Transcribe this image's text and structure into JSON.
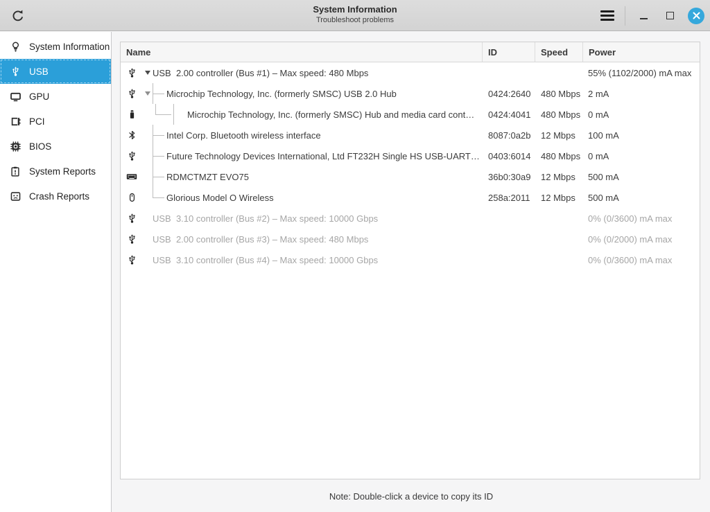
{
  "window": {
    "title": "System Information",
    "subtitle": "Troubleshoot problems"
  },
  "titlebar_icons": [
    "refresh-icon",
    "hamburger-menu-icon",
    "minimize-icon",
    "maximize-icon",
    "close-icon"
  ],
  "sidebar": {
    "items": [
      {
        "label": "System Information",
        "icon": "lightbulb",
        "selected": false
      },
      {
        "label": "USB",
        "icon": "usb",
        "selected": true
      },
      {
        "label": "GPU",
        "icon": "monitor",
        "selected": false
      },
      {
        "label": "PCI",
        "icon": "pci-card",
        "selected": false
      },
      {
        "label": "BIOS",
        "icon": "chip",
        "selected": false
      },
      {
        "label": "System Reports",
        "icon": "report",
        "selected": false
      },
      {
        "label": "Crash Reports",
        "icon": "crash",
        "selected": false
      }
    ]
  },
  "table": {
    "columns": [
      "Name",
      "ID",
      "Speed",
      "Power"
    ],
    "rows": [
      {
        "name": "USB  2.00 controller (Bus #1) – Max speed: 480 Mbps",
        "id": "",
        "speed": "",
        "power": "55% (1102/2000) mA max",
        "icon": "usb",
        "tree": "root",
        "expander": "dark",
        "dimmed": false
      },
      {
        "name": "Microchip Technology, Inc. (formerly SMSC) USB 2.0 Hub",
        "id": "0424:2640",
        "speed": "480 Mbps",
        "power": "2 mA",
        "icon": "usb",
        "tree": "branch",
        "expander": "gray",
        "dimmed": false
      },
      {
        "name": "Microchip Technology, Inc. (formerly SMSC) Hub and media card cont…",
        "id": "0424:4041",
        "speed": "480 Mbps",
        "power": "0 mA",
        "icon": "flash-drive",
        "tree": "child-last",
        "expander": "none",
        "dimmed": false
      },
      {
        "name": "Intel Corp. Bluetooth wireless interface",
        "id": "8087:0a2b",
        "speed": "12 Mbps",
        "power": "100 mA",
        "icon": "bluetooth",
        "tree": "branch",
        "expander": "none",
        "dimmed": false
      },
      {
        "name": "Future Technology Devices International, Ltd FT232H Single HS USB-UART…",
        "id": "0403:6014",
        "speed": "480 Mbps",
        "power": "0 mA",
        "icon": "usb",
        "tree": "branch",
        "expander": "none",
        "dimmed": false
      },
      {
        "name": "RDMCTMZT EVO75",
        "id": "36b0:30a9",
        "speed": "12 Mbps",
        "power": "500 mA",
        "icon": "keyboard",
        "tree": "branch",
        "expander": "none",
        "dimmed": false
      },
      {
        "name": "Glorious Model O Wireless",
        "id": "258a:2011",
        "speed": "12 Mbps",
        "power": "500 mA",
        "icon": "mouse",
        "tree": "last",
        "expander": "none",
        "dimmed": false
      },
      {
        "name": "USB  3.10 controller (Bus #2) – Max speed: 10000 Gbps",
        "id": "",
        "speed": "",
        "power": "0% (0/3600) mA max",
        "icon": "usb",
        "tree": "root",
        "expander": "none",
        "dimmed": true
      },
      {
        "name": "USB  2.00 controller (Bus #3) – Max speed: 480 Mbps",
        "id": "",
        "speed": "",
        "power": "0% (0/2000) mA max",
        "icon": "usb",
        "tree": "root",
        "expander": "none",
        "dimmed": true
      },
      {
        "name": "USB  3.10 controller (Bus #4) – Max speed: 10000 Gbps",
        "id": "",
        "speed": "",
        "power": "0% (0/3600) mA max",
        "icon": "usb",
        "tree": "root",
        "expander": "none",
        "dimmed": true
      }
    ]
  },
  "footer": {
    "note": "Note: Double-click a device to copy its ID"
  },
  "colors": {
    "accent_selection": "#2b9fd9",
    "close_button": "#35a8dc",
    "dimmed_text": "#a6a6a6",
    "titlebar_bg": "#d8d8d8",
    "sidebar_bg": "#ffffff",
    "card_bg": "#ffffff"
  }
}
